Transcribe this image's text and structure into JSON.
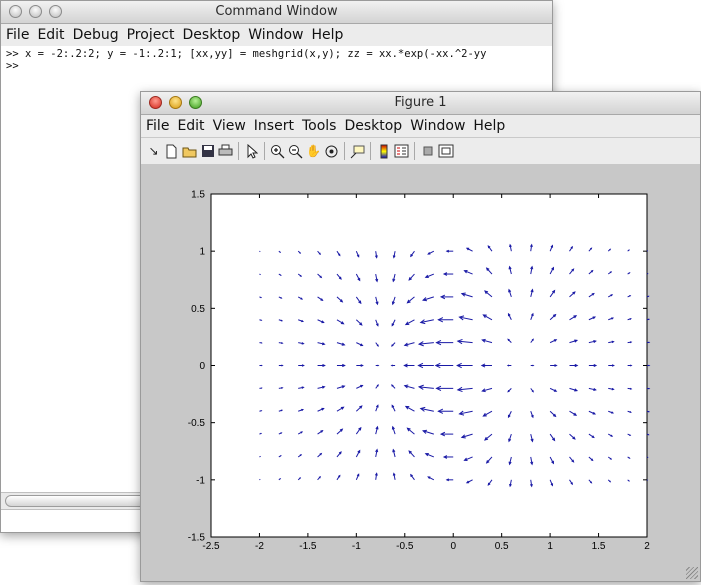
{
  "command_window": {
    "title": "Command Window",
    "menu": [
      "File",
      "Edit",
      "Debug",
      "Project",
      "Desktop",
      "Window",
      "Help"
    ],
    "lines": [
      ">> x = -2:.2:2; y = -1:.2:1; [xx,yy] = meshgrid(x,y); zz = xx.*exp(-xx.^2-yy",
      ">>"
    ]
  },
  "figure_window": {
    "title": "Figure 1",
    "menu": [
      "File",
      "Edit",
      "View",
      "Insert",
      "Tools",
      "Desktop",
      "Window",
      "Help"
    ],
    "toolbar_icons": [
      "arrow-icon",
      "new-figure-icon",
      "open-folder-icon",
      "save-icon",
      "print-icon",
      "pointer-icon",
      "zoom-in-icon",
      "zoom-out-icon",
      "pan-hand-icon",
      "rotate-3d-icon",
      "data-cursor-icon",
      "colorbar-icon",
      "legend-icon",
      "hide-plot-tools-icon",
      "show-plot-tools-icon"
    ]
  },
  "chart_data": {
    "type": "quiver",
    "title": "",
    "xlabel": "",
    "ylabel": "",
    "xlim": [
      -2.5,
      2
    ],
    "ylim": [
      -1.5,
      1.5
    ],
    "xticks": [
      "-2.5",
      "-2",
      "-1.5",
      "-1",
      "-0.5",
      "0",
      "0.5",
      "1",
      "1.5",
      "2"
    ],
    "yticks": [
      "-1.5",
      "-1",
      "-0.5",
      "0",
      "0.5",
      "1",
      "1.5"
    ],
    "grid_x": {
      "start": -2,
      "step": 0.2,
      "end": 2
    },
    "grid_y": {
      "start": -1,
      "step": 0.2,
      "end": 1
    },
    "arrow_color": "#1a1aa6",
    "field": "negative gradient of z = x*exp(-x^2-y^2)"
  }
}
